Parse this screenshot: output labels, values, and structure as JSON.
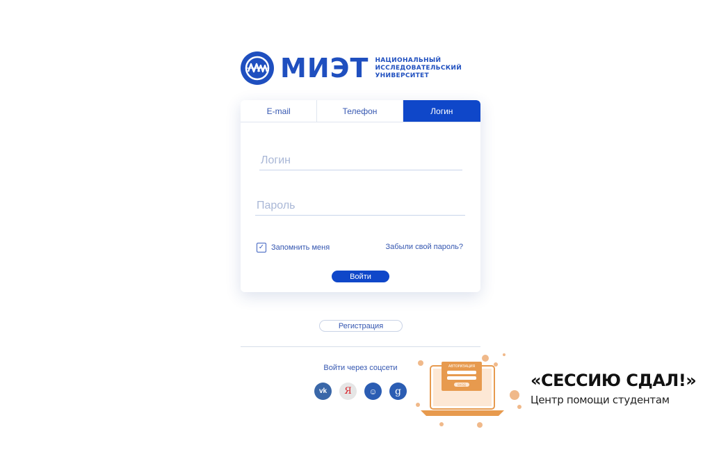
{
  "logo": {
    "wordmark": "МИЭТ",
    "subtitle_lines": [
      "НАЦИОНАЛЬНЫЙ",
      "ИССЛЕДОВАТЕЛЬСКИЙ",
      "УНИВЕРСИТЕТ"
    ],
    "emblem_icon": "miet-emblem-icon",
    "brand_color": "#1f4fbf"
  },
  "tabs": [
    {
      "label": "E-mail",
      "active": false
    },
    {
      "label": "Телефон",
      "active": false
    },
    {
      "label": "Логин",
      "active": true
    }
  ],
  "form": {
    "login_placeholder": "Логин",
    "login_value": "",
    "password_placeholder": "Пароль",
    "password_value": "",
    "remember_label": "Запомнить меня",
    "remember_checked": true,
    "forgot_label": "Забыли свой пароль?",
    "submit_label": "Войти"
  },
  "register_label": "Регистрация",
  "social": {
    "title": "Войти через соцсети",
    "providers": [
      {
        "name": "vk",
        "glyph": "vk",
        "icon": "vk-icon",
        "color": "#3a67a8"
      },
      {
        "name": "yandex",
        "glyph": "Я",
        "icon": "yandex-icon",
        "color": "#d8232a"
      },
      {
        "name": "mailru",
        "glyph": "☺",
        "icon": "mailru-icon",
        "color": "#2b5db3"
      },
      {
        "name": "google",
        "glyph": "g",
        "icon": "google-icon",
        "color": "#2b5db3"
      }
    ]
  },
  "watermark": {
    "title": "«СЕССИЮ СДАЛ!»",
    "subtitle": "Центр помощи студентам",
    "screen_heading": "АВТОРИЗАЦИЯ",
    "screen_button": "ВХОД",
    "accent_color": "#e79a4e"
  },
  "colors": {
    "accent": "#0f47c9",
    "link": "#3456b0"
  }
}
